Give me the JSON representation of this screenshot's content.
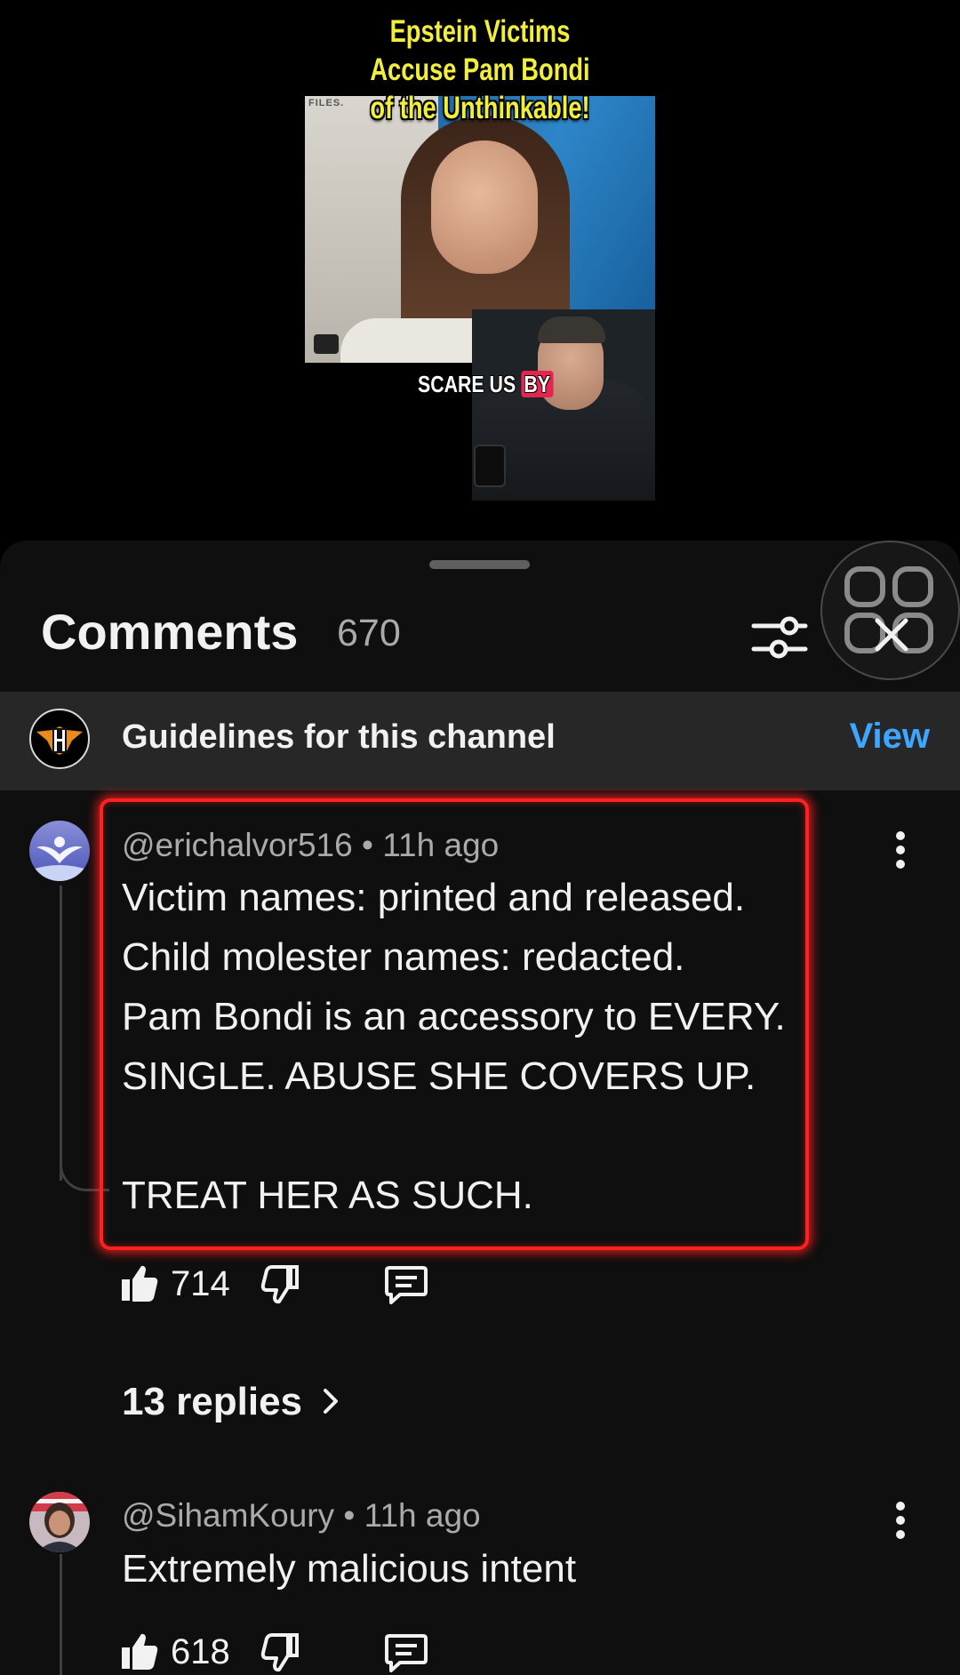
{
  "video": {
    "title_lines": [
      "Epstein Victims",
      "Accuse Pam Bondi",
      "of the Unthinkable!"
    ],
    "thumb_corner_text": "FILES.",
    "caption_main": "SCARE US",
    "caption_tag": "BY"
  },
  "comments_panel": {
    "title": "Comments",
    "count": "670",
    "filter_icon": "tune-sliders-icon",
    "close_icon": "close-icon"
  },
  "guidelines": {
    "text": "Guidelines for this channel",
    "action": "View"
  },
  "comments": [
    {
      "author": "@erichalvor516",
      "separator": "•",
      "time": "11h ago",
      "text": "Victim names: printed and released.\nChild molester names: redacted.\nPam Bondi is an accessory to EVERY.\nSINGLE. ABUSE SHE COVERS UP.\n\nTREAT HER AS SUCH.",
      "likes": "714",
      "replies_label": "13 replies",
      "highlighted": true
    },
    {
      "author": "@SihamKoury",
      "separator": "•",
      "time": "11h ago",
      "text": "Extremely malicious intent",
      "likes": "618"
    }
  ],
  "colors": {
    "sheet_bg": "#0f0f0f",
    "guidelines_bg": "#272727",
    "link_blue": "#3ea6ff",
    "highlight_red": "#ff2020",
    "title_yellow": "#f2ee3c"
  }
}
